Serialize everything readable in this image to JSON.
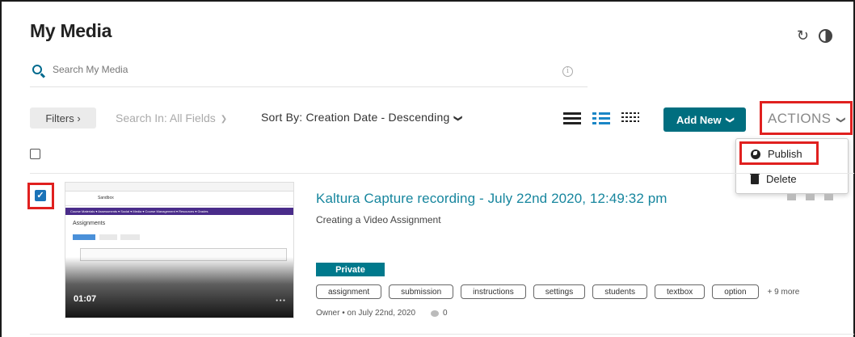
{
  "header": {
    "title": "My Media",
    "refresh_icon": "refresh-icon",
    "contrast_icon": "contrast-icon"
  },
  "search": {
    "placeholder": "Search My Media",
    "info_symbol": "i"
  },
  "toolbar": {
    "filters_label": "Filters ›",
    "search_in_label": "Search In: All Fields",
    "sort_by_label": "Sort By: Creation Date - Descending",
    "views": [
      "list-view-icon",
      "detailed-view-icon",
      "compact-view-icon"
    ],
    "add_new_label": "Add New",
    "actions_label": "ACTIONS"
  },
  "actions_menu": {
    "items": [
      {
        "label": "Publish",
        "icon": "globe-icon",
        "highlighted": true
      },
      {
        "label": "Delete",
        "icon": "trash-icon",
        "highlighted": false
      }
    ]
  },
  "media": {
    "selected": true,
    "title": "Kaltura Capture recording - July 22nd 2020, 12:49:32 pm",
    "description": "Creating a Video Assignment",
    "duration": "01:07",
    "privacy": "Private",
    "tags": [
      "assignment",
      "submission",
      "instructions",
      "settings",
      "students",
      "textbox",
      "option"
    ],
    "more_tags": "+ 9 more",
    "owner_line": "Owner • on July 22nd, 2020",
    "comment_count": "0",
    "thumbnail": {
      "site_name": "Sandbox",
      "nav_text": "Course Materials ▾   Assessments ▾   Social ▾   Media ▾   Course Management ▾   Resources ▾   Grades",
      "heading": "Assignments"
    }
  },
  "colors": {
    "accent_teal": "#006e7f",
    "link": "#17869e",
    "highlight_red": "#e0201f",
    "checkbox_blue": "#1a73b8"
  }
}
